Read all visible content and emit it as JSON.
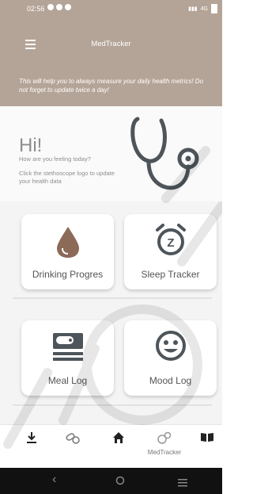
{
  "statusbar": {
    "time": "02:56",
    "network": "4G"
  },
  "appbar": {
    "title": "MedTracker"
  },
  "banner": {
    "text": "This will help you to always measure your daily health metrics! Do not forget to update twice a day!"
  },
  "greeting": {
    "title": "Hi!",
    "subtitle": "How are you feeling today?",
    "hint": "Click the stethoscope logo to update your health data"
  },
  "cards": [
    {
      "label": "Drinking Progres",
      "icon": "water-drop-icon"
    },
    {
      "label": "Sleep Tracker",
      "icon": "alarm-clock-icon"
    },
    {
      "label": "Meal Log",
      "icon": "meal-icon"
    },
    {
      "label": "Mood Log",
      "icon": "smiley-icon"
    }
  ],
  "bottomnav": {
    "items": [
      {
        "icon": "download-icon",
        "label": ""
      },
      {
        "icon": "pills-icon",
        "label": ""
      },
      {
        "icon": "home-icon",
        "label": ""
      },
      {
        "icon": "medtracker-icon",
        "label": "MedTracker"
      },
      {
        "icon": "book-icon",
        "label": ""
      }
    ]
  },
  "colors": {
    "accent": "#b4a497",
    "icon_brown": "#8b6a57",
    "icon_dark": "#4e555a"
  }
}
